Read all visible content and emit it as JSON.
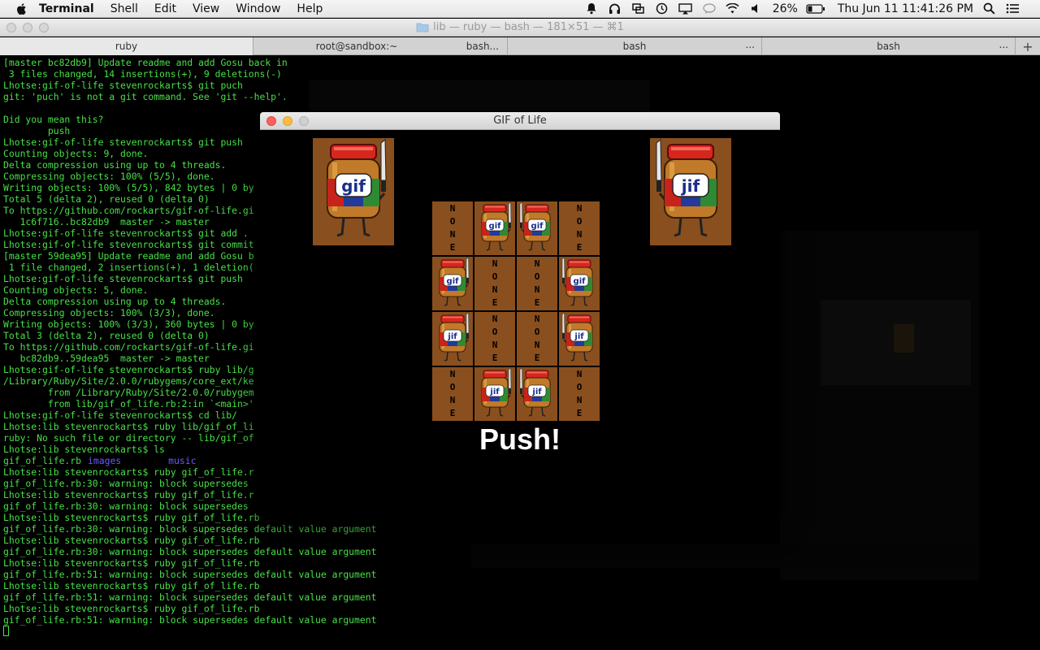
{
  "menubar": {
    "app": "Terminal",
    "items": [
      "Shell",
      "Edit",
      "View",
      "Window",
      "Help"
    ],
    "battery": "26%",
    "clock": "Thu Jun 11  11:41:26 PM"
  },
  "terminal": {
    "title": "lib — ruby — bash — 181×51 — ⌘1",
    "tabs": [
      "ruby",
      "root@sandbox:~",
      "bash...",
      "bash",
      "bash"
    ],
    "tab_more": "...",
    "tab_add": "+",
    "lines": [
      "[master bc82db9] Update readme and add Gosu back in",
      " 3 files changed, 14 insertions(+), 9 deletions(-)",
      "Lhotse:gif-of-life stevenrockarts$ git puch",
      "git: 'puch' is not a git command. See 'git --help'.",
      "",
      "Did you mean this?",
      "        push",
      "Lhotse:gif-of-life stevenrockarts$ git push",
      "Counting objects: 9, done.",
      "Delta compression using up to 4 threads.",
      "Compressing objects: 100% (5/5), done.",
      "Writing objects: 100% (5/5), 842 bytes | 0 by",
      "Total 5 (delta 2), reused 0 (delta 0)",
      "To https://github.com/rockarts/gif-of-life.gi",
      "   1c6f716..bc82db9  master -> master",
      "Lhotse:gif-of-life stevenrockarts$ git add .",
      "Lhotse:gif-of-life stevenrockarts$ git commit",
      "[master 59dea95] Update readme and add Gosu b",
      " 1 file changed, 2 insertions(+), 1 deletion(",
      "Lhotse:gif-of-life stevenrockarts$ git push",
      "Counting objects: 5, done.",
      "Delta compression using up to 4 threads.",
      "Compressing objects: 100% (3/3), done.",
      "Writing objects: 100% (3/3), 360 bytes | 0 by",
      "Total 3 (delta 2), reused 0 (delta 0)",
      "To https://github.com/rockarts/gif-of-life.gi",
      "   bc82db9..59dea95  master -> master",
      "Lhotse:gif-of-life stevenrockarts$ ruby lib/g",
      "/Library/Ruby/Site/2.0.0/rubygems/core_ext/ke",
      "        from /Library/Ruby/Site/2.0.0/rubygem",
      "        from lib/gif_of_life.rb:2:in `<main>'",
      "Lhotse:gif-of-life stevenrockarts$ cd lib/",
      "Lhotse:lib stevenrockarts$ ruby lib/gif_of_li",
      "ruby: No such file or directory -- lib/gif_of",
      "Lhotse:lib stevenrockarts$ ls",
      "",
      "Lhotse:lib stevenrockarts$ ruby gif_of_life.r",
      "gif_of_life.rb:30: warning: block supersedes",
      "Lhotse:lib stevenrockarts$ ruby gif_of_life.r",
      "gif_of_life.rb:30: warning: block supersedes",
      "Lhotse:lib stevenrockarts$ ruby gif_of_life.rb",
      "gif_of_life.rb:30: warning: block supersedes default value argument",
      "Lhotse:lib stevenrockarts$ ruby gif_of_life.rb",
      "gif_of_life.rb:30: warning: block supersedes default value argument",
      "Lhotse:lib stevenrockarts$ ruby gif_of_life.rb",
      "gif_of_life.rb:51: warning: block supersedes default value argument",
      "Lhotse:lib stevenrockarts$ ruby gif_of_life.rb",
      "gif_of_life.rb:51: warning: block supersedes default value argument",
      "Lhotse:lib stevenrockarts$ ruby gif_of_life.rb",
      "gif_of_life.rb:51: warning: block supersedes default value argument"
    ],
    "ls_output": {
      "file": "gif_of_life.rb",
      "dir1": "images",
      "dir2": "music"
    }
  },
  "game": {
    "title": "GIF of Life",
    "jar_left_label": "gif",
    "jar_right_label": "jif",
    "cell_none": "none",
    "grid": [
      [
        "none",
        "gif",
        "gif",
        "none"
      ],
      [
        "gif",
        "none",
        "none",
        "gif"
      ],
      [
        "jif",
        "none",
        "none",
        "jif"
      ],
      [
        "none",
        "jif",
        "jif",
        "none"
      ]
    ],
    "status": "Push!"
  },
  "colors": {
    "terminal_text": "#48e048",
    "terminal_dir": "#6b59ff",
    "cell_brown": "#8a4f1e",
    "jar_lid": "#d8261f"
  }
}
